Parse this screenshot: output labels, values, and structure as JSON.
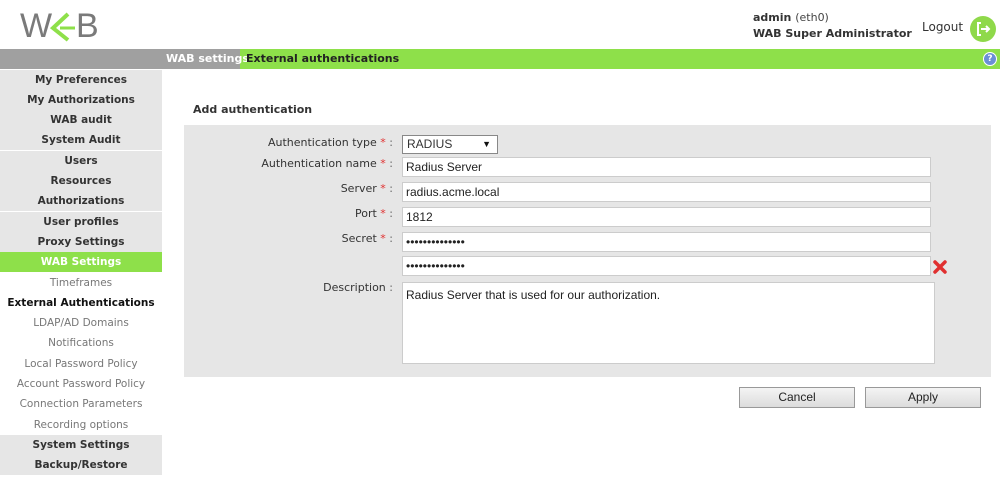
{
  "header": {
    "user_name": "admin",
    "user_iface": "(eth0)",
    "user_role": "WAB Super Administrator",
    "logout_label": "Logout"
  },
  "breadcrumb": {
    "section": "WAB settings",
    "page": "External authentications"
  },
  "sidebar": {
    "items": [
      {
        "label": "My Preferences"
      },
      {
        "label": "My Authorizations"
      },
      {
        "label": "WAB audit"
      },
      {
        "label": "System Audit"
      },
      {
        "label": "Users"
      },
      {
        "label": "Resources"
      },
      {
        "label": "Authorizations"
      },
      {
        "label": "User profiles"
      },
      {
        "label": "Proxy Settings"
      },
      {
        "label": "WAB Settings"
      },
      {
        "label": "Timeframes"
      },
      {
        "label": "External Authentications"
      },
      {
        "label": "LDAP/AD Domains"
      },
      {
        "label": "Notifications"
      },
      {
        "label": "Local Password Policy"
      },
      {
        "label": "Account Password Policy"
      },
      {
        "label": "Connection Parameters"
      },
      {
        "label": "Recording options"
      },
      {
        "label": "System Settings"
      },
      {
        "label": "Backup/Restore"
      }
    ]
  },
  "form": {
    "title": "Add authentication",
    "auth_type_label": "Authentication type",
    "auth_type_value": "RADIUS",
    "auth_name_label": "Authentication name",
    "auth_name_value": "Radius Server",
    "server_label": "Server",
    "server_value": "radius.acme.local",
    "port_label": "Port",
    "port_value": "1812",
    "secret_label": "Secret",
    "secret_value": "••••••••••••••",
    "secret_confirm_value": "••••••••••••••",
    "description_label": "Description",
    "description_value": "Radius Server that is used for our authorization.",
    "required_mark": "*",
    "colon": ":"
  },
  "actions": {
    "cancel_label": "Cancel",
    "apply_label": "Apply"
  },
  "colors": {
    "accent_green": "#8ee04a",
    "sidebar_gray": "#e6e6e6",
    "error_red": "#e03030"
  },
  "icons": {
    "logout": "logout-arrow-icon",
    "help": "help-icon",
    "clear": "red-x-icon"
  }
}
